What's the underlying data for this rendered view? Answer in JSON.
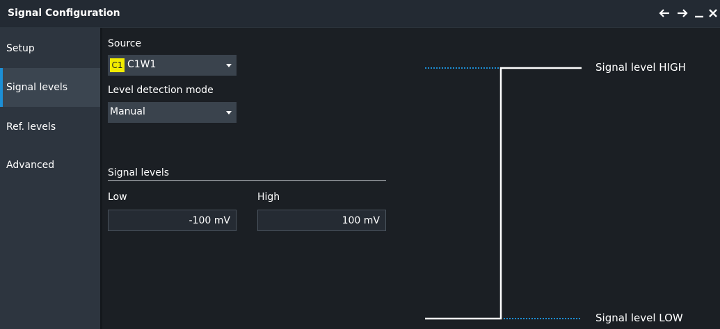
{
  "window": {
    "title": "Signal Configuration",
    "controls": [
      "back-arrow-icon",
      "forward-arrow-icon",
      "minimize-icon",
      "close-icon"
    ]
  },
  "sidebar": {
    "items": [
      {
        "label": "Setup",
        "active": false
      },
      {
        "label": "Signal levels",
        "active": true
      },
      {
        "label": "Ref. levels",
        "active": false
      },
      {
        "label": "Advanced",
        "active": false
      }
    ]
  },
  "form": {
    "source_label": "Source",
    "source_badge": "C1",
    "source_value": "C1W1",
    "mode_label": "Level detection mode",
    "mode_value": "Manual",
    "section_title": "Signal levels",
    "low_label": "Low",
    "low_value": "-100 mV",
    "high_label": "High",
    "high_value": "100 mV"
  },
  "diagram": {
    "high_label": "Signal level HIGH",
    "low_label": "Signal level LOW"
  },
  "colors": {
    "accent": "#1c8fd6",
    "badge": "#f2ec00",
    "sidebar_bg": "#2d353f",
    "sidebar_active": "#3b4550",
    "title_bg": "#232a33",
    "field_bg": "#3a434d"
  }
}
